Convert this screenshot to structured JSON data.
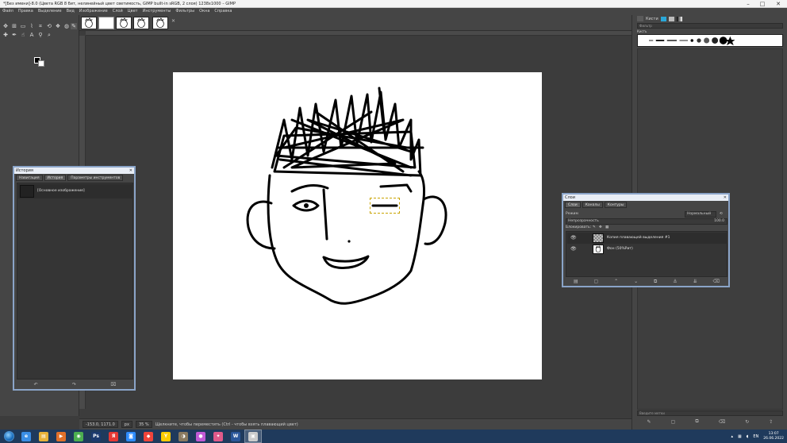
{
  "window": {
    "title": "*[Без имени]-8.0 (Цвета RGB 8 бит, нелинейный цвет светимость, GIMP built-in sRGB, 2 слоя) 1238x1000 – GIMP",
    "controls": [
      "–",
      "□",
      "✕"
    ]
  },
  "menu": [
    "Файл",
    "Правка",
    "Выделение",
    "Вид",
    "Изображение",
    "Слой",
    "Цвет",
    "Инструменты",
    "Фильтры",
    "Окна",
    "Справка"
  ],
  "dock": {
    "tab_label": "Кисти",
    "brush_tag": "Кисть",
    "filter_label": "Фильтр",
    "tag_entry": "Введите метки"
  },
  "history_window": {
    "title": "История",
    "tabs": [
      "Навигация",
      "История",
      "Параметры инструментов"
    ],
    "entry": "[Основное изображение]"
  },
  "layers_window": {
    "title": "Слои",
    "tabs": [
      "Слои",
      "Каналы",
      "Контуры"
    ],
    "mode_label": "Режим",
    "mode_value": "Нормальный",
    "opacity_label": "Непрозрачность",
    "opacity_value": "100.0",
    "lock_label": "Блокировать:",
    "layers": [
      {
        "name": "Копия плавающей выделения #1",
        "visible": true,
        "thumb": "checker"
      },
      {
        "name": "Фон (50%Рит)",
        "visible": true,
        "thumb": "face"
      }
    ]
  },
  "statusbar": {
    "coords": "-153.0, 1171.0",
    "unit": "px",
    "zoom": "35 %",
    "message": "Щелкните, чтобы переместить (Ctrl - чтобы взять плавающий цвет)"
  },
  "taskbar": {
    "apps": [
      {
        "name": "ie-icon",
        "label": "e",
        "color": "#3a8ee6"
      },
      {
        "name": "explorer-icon",
        "label": "▤",
        "color": "#e6b23a"
      },
      {
        "name": "media-player-icon",
        "label": "▶",
        "color": "#e0702a"
      },
      {
        "name": "chrome-icon",
        "label": "◉",
        "color": "#4caf50"
      },
      {
        "name": "photoshop-icon",
        "label": "Ps",
        "color": "#1c3a6e"
      },
      {
        "name": "yandex-icon",
        "label": "Я",
        "color": "#e53935"
      },
      {
        "name": "zoom-icon",
        "label": "◙",
        "color": "#2d8cff"
      },
      {
        "name": "anydesk-icon",
        "label": "◆",
        "color": "#ef443b"
      },
      {
        "name": "yandex-browser-icon",
        "label": "Y",
        "color": "#ffcc00"
      },
      {
        "name": "gimp-icon",
        "label": "◑",
        "color": "#8a7a60"
      },
      {
        "name": "paint-icon",
        "label": "●",
        "color": "#c25ad6"
      },
      {
        "name": "gamepad-icon",
        "label": "✦",
        "color": "#e05a8a"
      },
      {
        "name": "word-icon",
        "label": "W",
        "color": "#2b579a"
      },
      {
        "name": "gimp-window-icon",
        "label": "▣",
        "color": "#cccccc"
      }
    ],
    "language": "EN",
    "time": "13:07",
    "date": "26.06.2022"
  },
  "colors": {
    "accent": "#8aa4c8",
    "canvas": "#ffffff",
    "taskbar": "#1f3a5c"
  }
}
